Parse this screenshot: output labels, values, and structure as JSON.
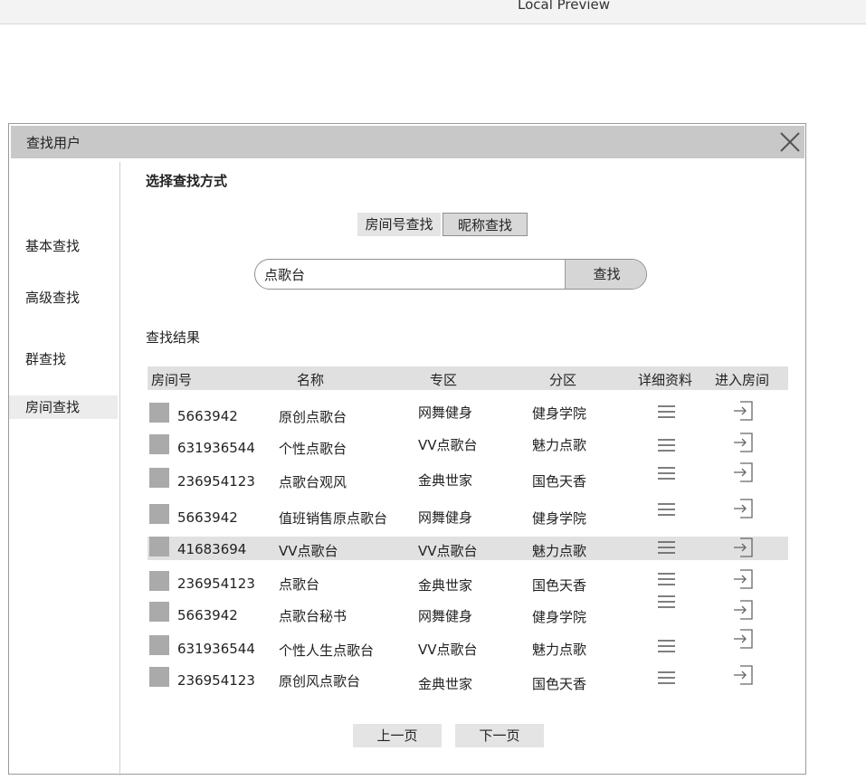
{
  "window": {
    "title": "Local Preview"
  },
  "dialog": {
    "title": "查找用户"
  },
  "sidebar": {
    "items": [
      {
        "label": "基本查找"
      },
      {
        "label": "高级查找"
      },
      {
        "label": "群查找"
      },
      {
        "label": "房间查找"
      }
    ]
  },
  "main": {
    "mode_title": "选择查找方式",
    "modes": {
      "room_number": "房间号查找",
      "nickname": "昵称查找"
    },
    "search": {
      "value": "点歌台",
      "button": "查找"
    },
    "results_title": "查找结果",
    "columns": [
      "房间号",
      "名称",
      "专区",
      "分区",
      "详细资料",
      "进入房间"
    ],
    "rows": [
      {
        "room": "5663942",
        "name": "原创点歌台",
        "zone": "网舞健身",
        "area": "健身学院"
      },
      {
        "room": "631936544",
        "name": "个性点歌台",
        "zone": "VV点歌台",
        "area": "魅力点歌"
      },
      {
        "room": "236954123",
        "name": "点歌台观风",
        "zone": "金典世家",
        "area": "国色天香"
      },
      {
        "room": "5663942",
        "name": "值班销售原点歌台",
        "zone": "网舞健身",
        "area": "健身学院"
      },
      {
        "room": "41683694",
        "name": "VV点歌台",
        "zone": "VV点歌台",
        "area": "魅力点歌"
      },
      {
        "room": "236954123",
        "name": "点歌台",
        "zone": "金典世家",
        "area": "国色天香"
      },
      {
        "room": "5663942",
        "name": "点歌台秘书",
        "zone": "网舞健身",
        "area": "健身学院"
      },
      {
        "room": "631936544",
        "name": "个性人生点歌台",
        "zone": "VV点歌台",
        "area": "魅力点歌"
      },
      {
        "room": "236954123",
        "name": "原创风点歌台",
        "zone": "金典世家",
        "area": "国色天香"
      }
    ],
    "pagination": {
      "prev": "上一页",
      "next": "下一页"
    }
  }
}
